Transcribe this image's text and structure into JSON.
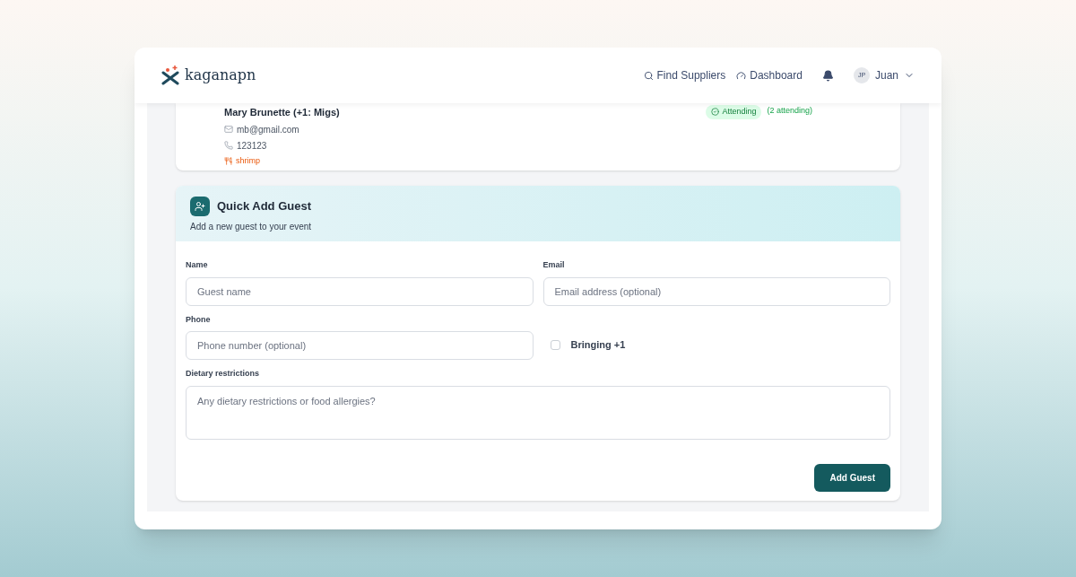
{
  "header": {
    "logo": "kaganapn",
    "nav": [
      {
        "kind": "search",
        "label": "Find Suppliers"
      },
      {
        "kind": "dashboard",
        "label": "Dashboard"
      }
    ],
    "user": {
      "initials": "JP",
      "name": "Juan"
    }
  },
  "guest": {
    "name": "Mary Brunette (+1: Migs)",
    "email": "mb@gmail.com",
    "phone": "123123",
    "dietary": "shrimp",
    "status": "Attending",
    "count": "(2 attending)"
  },
  "quick_add": {
    "title": "Quick Add Guest",
    "subtitle": "Add a new guest to your event",
    "fields": [
      {
        "kind": "input",
        "label": "Name",
        "placeholder": "Guest name"
      },
      {
        "kind": "input",
        "label": "Email",
        "placeholder": "Email address (optional)"
      },
      {
        "kind": "input",
        "label": "Phone",
        "placeholder": "Phone number (optional)"
      },
      {
        "kind": "checkbox",
        "label": "Bringing +1",
        "checked": false
      },
      {
        "kind": "textarea",
        "label": "Dietary restrictions",
        "placeholder": "Any dietary restrictions or food allergies?"
      }
    ],
    "submit": "Add Guest"
  }
}
